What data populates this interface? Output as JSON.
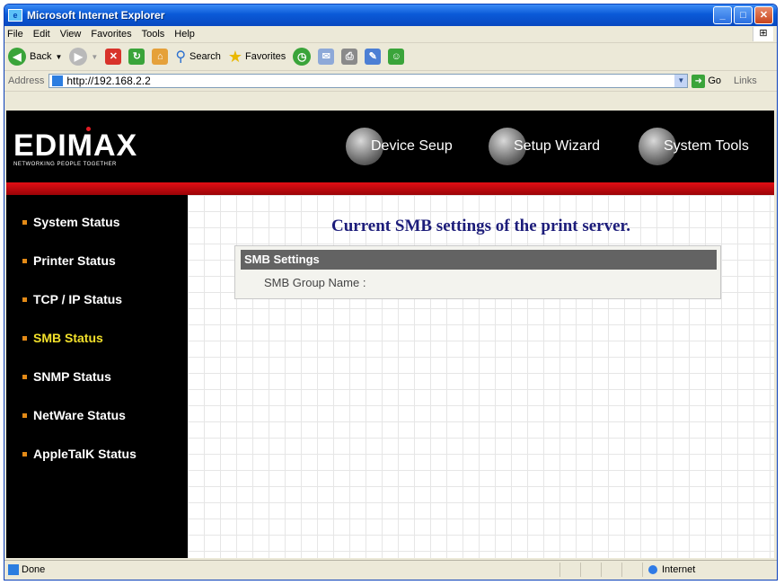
{
  "window": {
    "title": "Microsoft Internet Explorer"
  },
  "menu": [
    "File",
    "Edit",
    "View",
    "Favorites",
    "Tools",
    "Help"
  ],
  "toolbar": {
    "back": "Back",
    "search": "Search",
    "favorites": "Favorites"
  },
  "address": {
    "label": "Address",
    "url": "http://192.168.2.2",
    "go": "Go",
    "links": "Links"
  },
  "header": {
    "brand": "EDIMAX",
    "tagline": "NETWORKING PEOPLE TOGETHER",
    "nav": [
      "Device Seup",
      "Setup Wizard",
      "System Tools"
    ]
  },
  "sidebar": {
    "items": [
      "System Status",
      "Printer Status",
      "TCP / IP Status",
      "SMB Status",
      "SNMP Status",
      "NetWare Status",
      "AppleTalK Status"
    ],
    "active": "SMB Status"
  },
  "main": {
    "heading": "Current SMB settings of the print server.",
    "panel_title": "SMB Settings",
    "field_label": "SMB Group Name :",
    "field_value": ""
  },
  "status": {
    "text": "Done",
    "zone": "Internet"
  },
  "colors": {
    "accent_red": "#e30e14",
    "active_item": "#f2e02b",
    "heading": "#1c1c7a"
  }
}
